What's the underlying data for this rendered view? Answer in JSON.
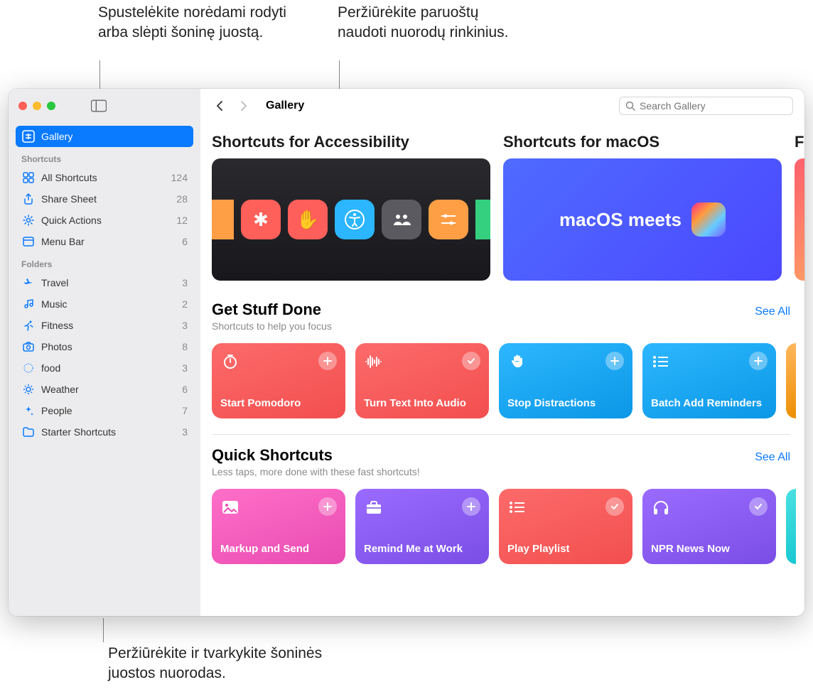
{
  "callouts": {
    "top_left": "Spustelėkite norėdami rodyti arba slėpti šoninę juostą.",
    "top_right": "Peržiūrėkite paruoštų naudoti nuorodų rinkinius.",
    "bottom": "Peržiūrėkite ir tvarkykite šoninės juostos nuorodas."
  },
  "toolbar": {
    "title": "Gallery",
    "search_placeholder": "Search Gallery"
  },
  "sidebar": {
    "gallery": "Gallery",
    "shortcuts_header": "Shortcuts",
    "shortcuts": [
      {
        "label": "All Shortcuts",
        "count": "124"
      },
      {
        "label": "Share Sheet",
        "count": "28"
      },
      {
        "label": "Quick Actions",
        "count": "12"
      },
      {
        "label": "Menu Bar",
        "count": "6"
      }
    ],
    "folders_header": "Folders",
    "folders": [
      {
        "label": "Travel",
        "count": "3"
      },
      {
        "label": "Music",
        "count": "2"
      },
      {
        "label": "Fitness",
        "count": "3"
      },
      {
        "label": "Photos",
        "count": "8"
      },
      {
        "label": "food",
        "count": "3"
      },
      {
        "label": "Weather",
        "count": "6"
      },
      {
        "label": "People",
        "count": "7"
      },
      {
        "label": "Starter Shortcuts",
        "count": "3"
      }
    ]
  },
  "hero": {
    "items": [
      {
        "title": "Shortcuts for Accessibility"
      },
      {
        "title": "Shortcuts for macOS",
        "banner_text": "macOS meets"
      },
      {
        "title": "F"
      }
    ]
  },
  "sections": [
    {
      "title": "Get Stuff Done",
      "subtitle": "Shortcuts to help you focus",
      "see_all": "See All",
      "tiles": [
        {
          "name": "Start Pomodoro",
          "color": "red-t",
          "glyph": "timer",
          "badge": "plus"
        },
        {
          "name": "Turn Text Into Audio",
          "color": "red-t",
          "glyph": "wave",
          "badge": "check"
        },
        {
          "name": "Stop Distractions",
          "color": "blue-t",
          "glyph": "hand",
          "badge": "plus"
        },
        {
          "name": "Batch Add Reminders",
          "color": "blue-t",
          "glyph": "list",
          "badge": "plus"
        }
      ]
    },
    {
      "title": "Quick Shortcuts",
      "subtitle": "Less taps, more done with these fast shortcuts!",
      "see_all": "See All",
      "tiles": [
        {
          "name": "Markup and Send",
          "color": "pink-t",
          "glyph": "image",
          "badge": "plus"
        },
        {
          "name": "Remind Me at Work",
          "color": "purple-t",
          "glyph": "briefcase",
          "badge": "plus"
        },
        {
          "name": "Play Playlist",
          "color": "red-t",
          "glyph": "list",
          "badge": "check"
        },
        {
          "name": "NPR News Now",
          "color": "purple-t",
          "glyph": "headphones",
          "badge": "check"
        }
      ]
    }
  ]
}
